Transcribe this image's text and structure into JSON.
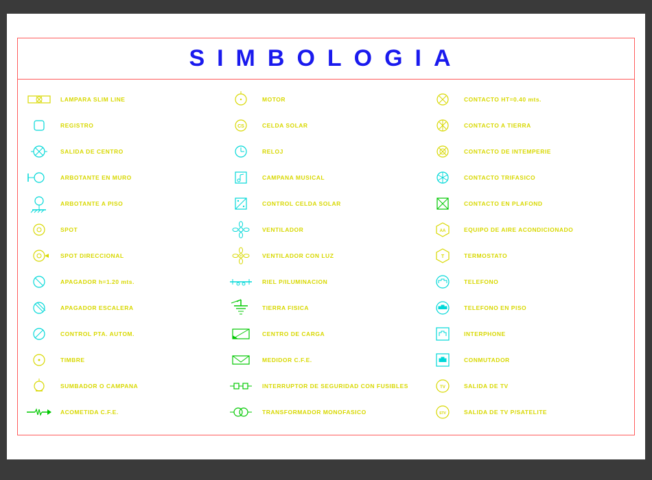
{
  "title": "SIMBOLOGIA",
  "columns": [
    {
      "items": [
        {
          "icon": "lamp-slimline",
          "label": "LAMPARA SLIM LINE"
        },
        {
          "icon": "registro",
          "label": "REGISTRO"
        },
        {
          "icon": "salida-centro",
          "label": "SALIDA DE CENTRO"
        },
        {
          "icon": "arbotante-muro",
          "label": "ARBOTANTE EN MURO"
        },
        {
          "icon": "arbotante-piso",
          "label": "ARBOTANTE A PISO"
        },
        {
          "icon": "spot",
          "label": "SPOT"
        },
        {
          "icon": "spot-dir",
          "label": "SPOT DIRECCIONAL"
        },
        {
          "icon": "apagador",
          "label": "APAGADOR h=1.20 mts."
        },
        {
          "icon": "apagador-esc",
          "label": "APAGADOR ESCALERA"
        },
        {
          "icon": "control-pta",
          "label": "CONTROL PTA. AUTOM."
        },
        {
          "icon": "timbre",
          "label": "TIMBRE"
        },
        {
          "icon": "sumbador",
          "label": "SUMBADOR O CAMPANA"
        },
        {
          "icon": "acometida",
          "label": "ACOMETIDA C.F.E."
        }
      ]
    },
    {
      "items": [
        {
          "icon": "motor",
          "label": "MOTOR"
        },
        {
          "icon": "celda-solar",
          "label": "CELDA SOLAR"
        },
        {
          "icon": "reloj",
          "label": "RELOJ"
        },
        {
          "icon": "campana-musical",
          "label": "CAMPANA MUSICAL"
        },
        {
          "icon": "control-celda",
          "label": "CONTROL CELDA SOLAR"
        },
        {
          "icon": "ventilador",
          "label": "VENTILADOR"
        },
        {
          "icon": "ventilador-luz",
          "label": "VENTILADOR CON LUZ"
        },
        {
          "icon": "riel",
          "label": "RIEL P/ILUMINACION"
        },
        {
          "icon": "tierra",
          "label": "TIERRA FISICA"
        },
        {
          "icon": "centro-carga",
          "label": "CENTRO DE CARGA"
        },
        {
          "icon": "medidor",
          "label": "MEDIDOR C.F.E."
        },
        {
          "icon": "interruptor-seg",
          "label": "INTERRUPTOR DE SEGURIDAD CON FUSIBLES"
        },
        {
          "icon": "transformador",
          "label": "TRANSFORMADOR MONOFASICO"
        }
      ]
    },
    {
      "items": [
        {
          "icon": "contacto-ht",
          "label": "CONTACTO HT=0.40 mts."
        },
        {
          "icon": "contacto-tierra",
          "label": "CONTACTO A TIERRA"
        },
        {
          "icon": "contacto-intemp",
          "label": "CONTACTO DE INTEMPERIE"
        },
        {
          "icon": "contacto-trif",
          "label": "CONTACTO TRIFASICO"
        },
        {
          "icon": "contacto-plafond",
          "label": "CONTACTO EN PLAFOND"
        },
        {
          "icon": "aire-acond",
          "label": "EQUIPO DE AIRE ACONDICIONADO"
        },
        {
          "icon": "termostato",
          "label": "TERMOSTATO"
        },
        {
          "icon": "telefono",
          "label": "TELEFONO"
        },
        {
          "icon": "telefono-piso",
          "label": "TELEFONO EN PISO"
        },
        {
          "icon": "interphone",
          "label": "INTERPHONE"
        },
        {
          "icon": "conmutador",
          "label": "CONMUTADOR"
        },
        {
          "icon": "salida-tv",
          "label": "SALIDA DE TV"
        },
        {
          "icon": "salida-tv-sat",
          "label": "SALIDA DE TV P/SATELITE"
        }
      ]
    }
  ],
  "colors": {
    "cyan": "#00d8d8",
    "yellow": "#d8d800",
    "green": "#00c800",
    "blue": "#1a1aee",
    "red": "#ff5a5a"
  }
}
